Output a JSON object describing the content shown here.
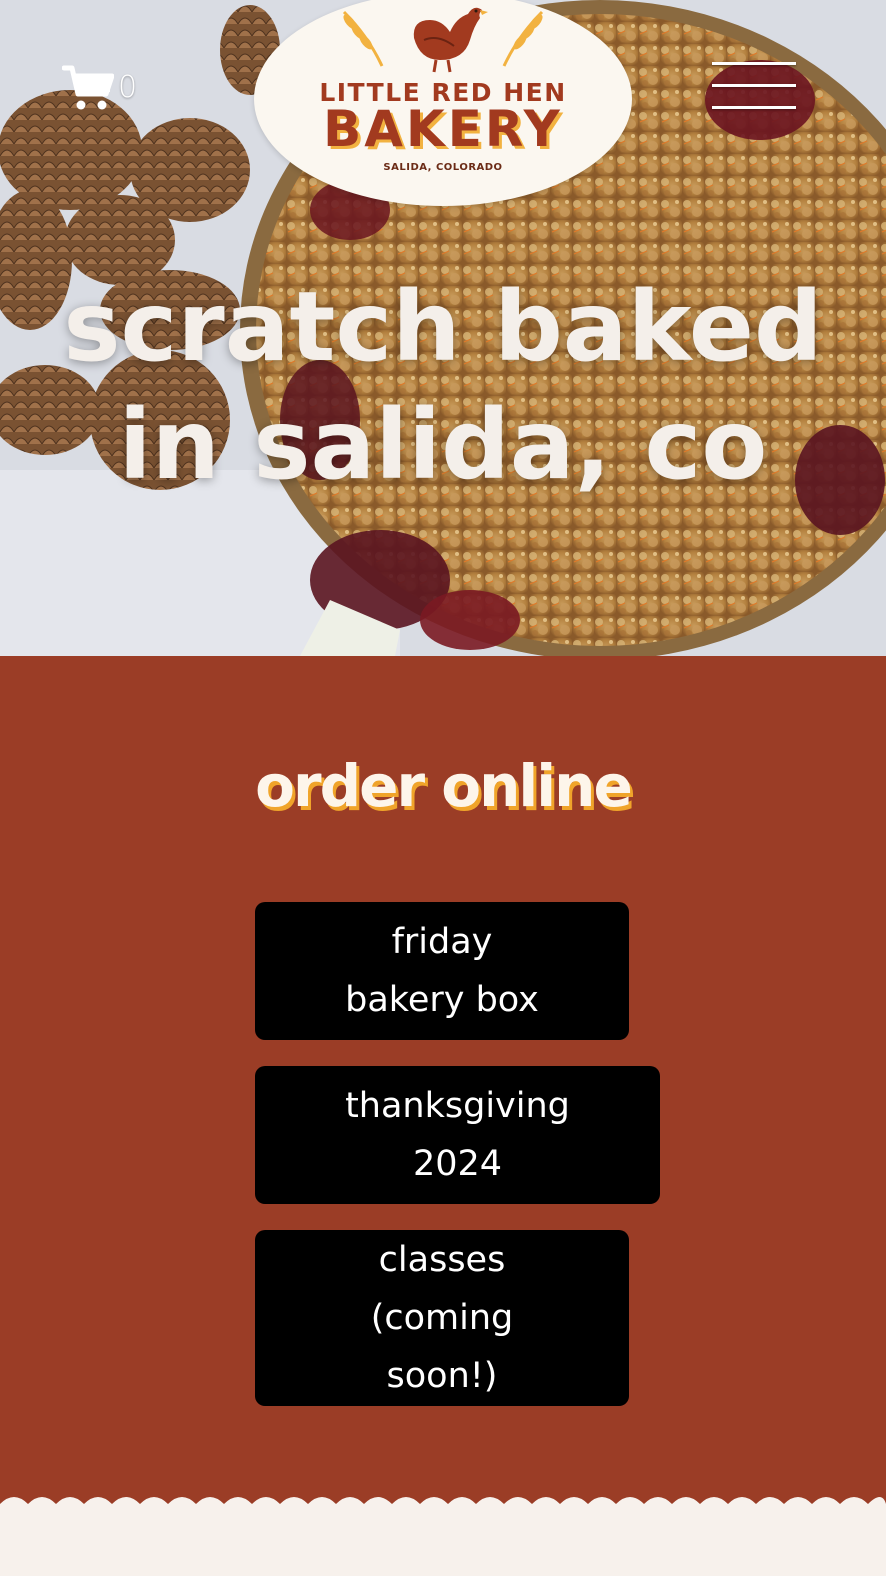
{
  "header": {
    "cart_count": "0",
    "logo": {
      "line1": "LITTLE RED HEN",
      "line2": "BAKERY",
      "line3": "SALIDA, COLORADO"
    }
  },
  "hero": {
    "title_line1": "scratch baked",
    "title_line2": "in salida, co"
  },
  "order": {
    "heading": "order online",
    "buttons": [
      {
        "label": "friday\nbakery box"
      },
      {
        "label": "thanksgiving\n2024"
      },
      {
        "label": "classes\n(coming\nsoon!)"
      }
    ]
  },
  "colors": {
    "section_bg": "#9b3d26",
    "button_bg": "#000000",
    "heading_shadow": "#f0a42a",
    "logo_red": "#a23a1f"
  },
  "icons": [
    "cart-icon",
    "hamburger-menu-icon",
    "hen-icon",
    "wheat-icon"
  ]
}
